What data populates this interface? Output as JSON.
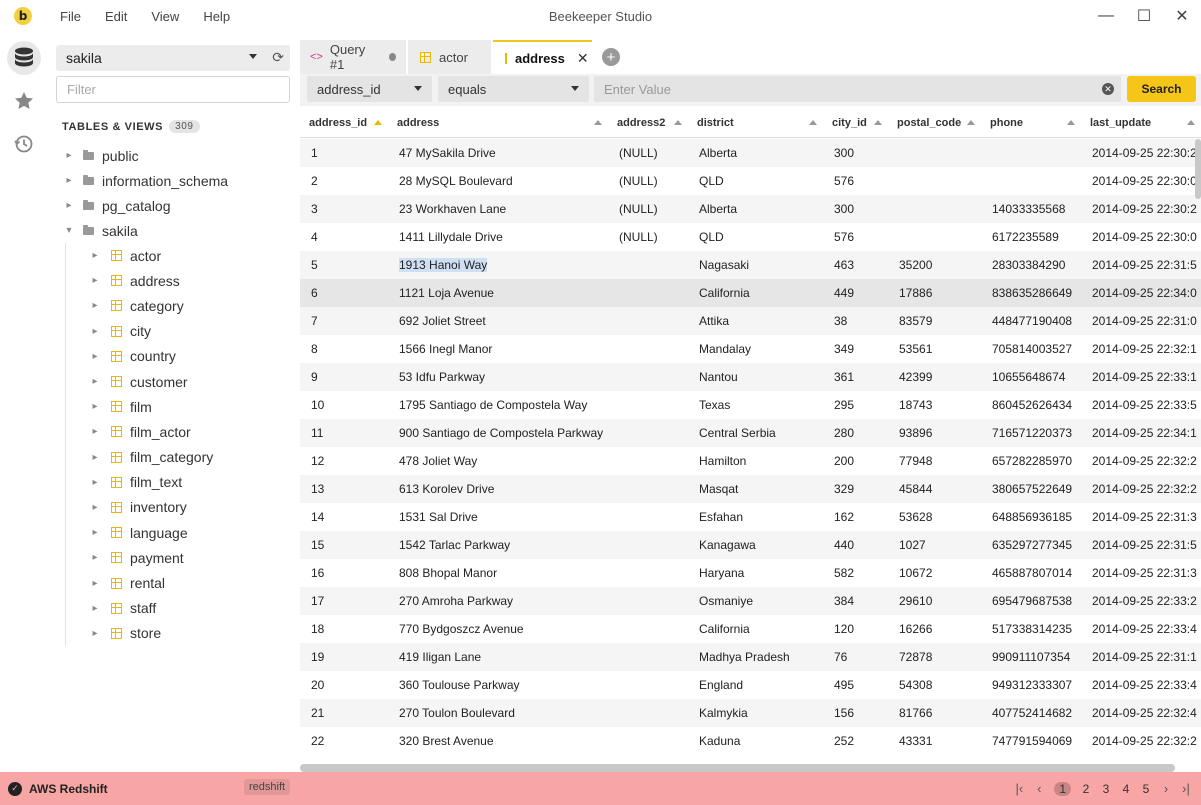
{
  "window": {
    "title": "Beekeeper Studio",
    "logo_letter": "b",
    "menu": [
      "File",
      "Edit",
      "View",
      "Help"
    ]
  },
  "sidebar": {
    "connection": "sakila",
    "filter_placeholder": "Filter",
    "tables_header": "TABLES & VIEWS",
    "tables_count": "309",
    "schemas": [
      "public",
      "information_schema",
      "pg_catalog",
      "sakila"
    ],
    "tables": [
      "actor",
      "address",
      "category",
      "city",
      "country",
      "customer",
      "film",
      "film_actor",
      "film_category",
      "film_text",
      "inventory",
      "language",
      "payment",
      "rental",
      "staff",
      "store"
    ]
  },
  "tabs": [
    {
      "label": "Query #1",
      "kind": "query"
    },
    {
      "label": "actor",
      "kind": "table"
    },
    {
      "label": "address",
      "kind": "table",
      "active": true
    }
  ],
  "filter": {
    "column": "address_id",
    "operator": "equals",
    "value_placeholder": "Enter Value",
    "search_label": "Search"
  },
  "grid": {
    "columns": [
      "address_id",
      "address",
      "address2",
      "district",
      "city_id",
      "postal_code",
      "phone",
      "last_update"
    ],
    "rows": [
      [
        "1",
        "47 MySakila Drive",
        "(NULL)",
        "Alberta",
        "300",
        "",
        "",
        "2014-09-25 22:30:2"
      ],
      [
        "2",
        "28 MySQL Boulevard",
        "(NULL)",
        "QLD",
        "576",
        "",
        "",
        "2014-09-25 22:30:0"
      ],
      [
        "3",
        "23 Workhaven Lane",
        "(NULL)",
        "Alberta",
        "300",
        "",
        "14033335568",
        "2014-09-25 22:30:2"
      ],
      [
        "4",
        "1411 Lillydale Drive",
        "(NULL)",
        "QLD",
        "576",
        "",
        "6172235589",
        "2014-09-25 22:30:0"
      ],
      [
        "5",
        "1913 Hanoi Way",
        "",
        "Nagasaki",
        "463",
        "35200",
        "28303384290",
        "2014-09-25 22:31:5"
      ],
      [
        "6",
        "1121 Loja Avenue",
        "",
        "California",
        "449",
        "17886",
        "838635286649",
        "2014-09-25 22:34:0"
      ],
      [
        "7",
        "692 Joliet Street",
        "",
        "Attika",
        "38",
        "83579",
        "448477190408",
        "2014-09-25 22:31:0"
      ],
      [
        "8",
        "1566 Inegl Manor",
        "",
        "Mandalay",
        "349",
        "53561",
        "705814003527",
        "2014-09-25 22:32:1"
      ],
      [
        "9",
        "53 Idfu Parkway",
        "",
        "Nantou",
        "361",
        "42399",
        "10655648674",
        "2014-09-25 22:33:1"
      ],
      [
        "10",
        "1795 Santiago de Compostela Way",
        "",
        "Texas",
        "295",
        "18743",
        "860452626434",
        "2014-09-25 22:33:5"
      ],
      [
        "11",
        "900 Santiago de Compostela Parkway",
        "",
        "Central Serbia",
        "280",
        "93896",
        "716571220373",
        "2014-09-25 22:34:1"
      ],
      [
        "12",
        "478 Joliet Way",
        "",
        "Hamilton",
        "200",
        "77948",
        "657282285970",
        "2014-09-25 22:32:2"
      ],
      [
        "13",
        "613 Korolev Drive",
        "",
        "Masqat",
        "329",
        "45844",
        "380657522649",
        "2014-09-25 22:32:2"
      ],
      [
        "14",
        "1531 Sal Drive",
        "",
        "Esfahan",
        "162",
        "53628",
        "648856936185",
        "2014-09-25 22:31:3"
      ],
      [
        "15",
        "1542 Tarlac Parkway",
        "",
        "Kanagawa",
        "440",
        "1027",
        "635297277345",
        "2014-09-25 22:31:5"
      ],
      [
        "16",
        "808 Bhopal Manor",
        "",
        "Haryana",
        "582",
        "10672",
        "465887807014",
        "2014-09-25 22:31:3"
      ],
      [
        "17",
        "270 Amroha Parkway",
        "",
        "Osmaniye",
        "384",
        "29610",
        "695479687538",
        "2014-09-25 22:33:2"
      ],
      [
        "18",
        "770 Bydgoszcz Avenue",
        "",
        "California",
        "120",
        "16266",
        "517338314235",
        "2014-09-25 22:33:4"
      ],
      [
        "19",
        "419 Iligan Lane",
        "",
        "Madhya Pradesh",
        "76",
        "72878",
        "990911107354",
        "2014-09-25 22:31:1"
      ],
      [
        "20",
        "360 Toulouse Parkway",
        "",
        "England",
        "495",
        "54308",
        "949312333307",
        "2014-09-25 22:33:4"
      ],
      [
        "21",
        "270 Toulon Boulevard",
        "",
        "Kalmykia",
        "156",
        "81766",
        "407752414682",
        "2014-09-25 22:32:4"
      ],
      [
        "22",
        "320 Brest Avenue",
        "",
        "Kaduna",
        "252",
        "43331",
        "747791594069",
        "2014-09-25 22:32:2"
      ]
    ],
    "selected_row_index": 5,
    "highlighted_cell": {
      "row": 4,
      "col": 1
    }
  },
  "status": {
    "connection_name": "AWS Redshift",
    "connection_type": "redshift",
    "pages": [
      "1",
      "2",
      "3",
      "4",
      "5"
    ],
    "current_page": "1"
  },
  "colors": {
    "accent": "#f5c518",
    "status_bar": "#f8a5a5"
  }
}
